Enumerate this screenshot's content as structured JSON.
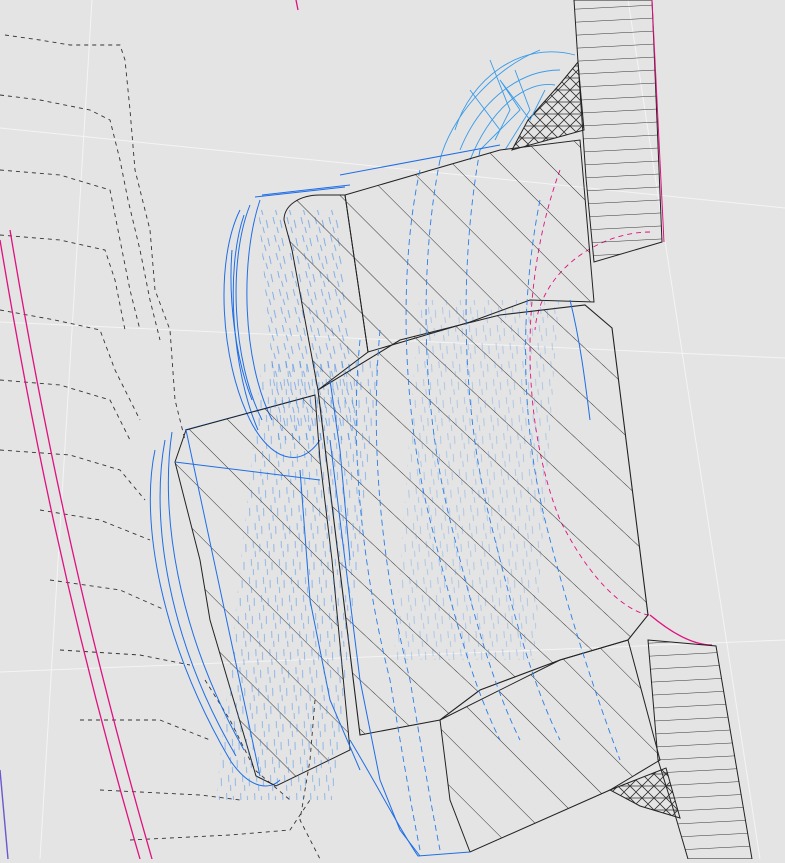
{
  "view": {
    "background": "#e4e4e4",
    "grid_color": "#f2f2f2",
    "colors": {
      "section_outline": "#222222",
      "hatch": "#333333",
      "wireframe_blue": "#1e6ee6",
      "wireframe_light": "#3a9be8",
      "hidden_dashed": "#333333",
      "magenta": "#e0117f",
      "violet": "#6a5acd"
    },
    "grid_visible": true,
    "text_labels": []
  }
}
